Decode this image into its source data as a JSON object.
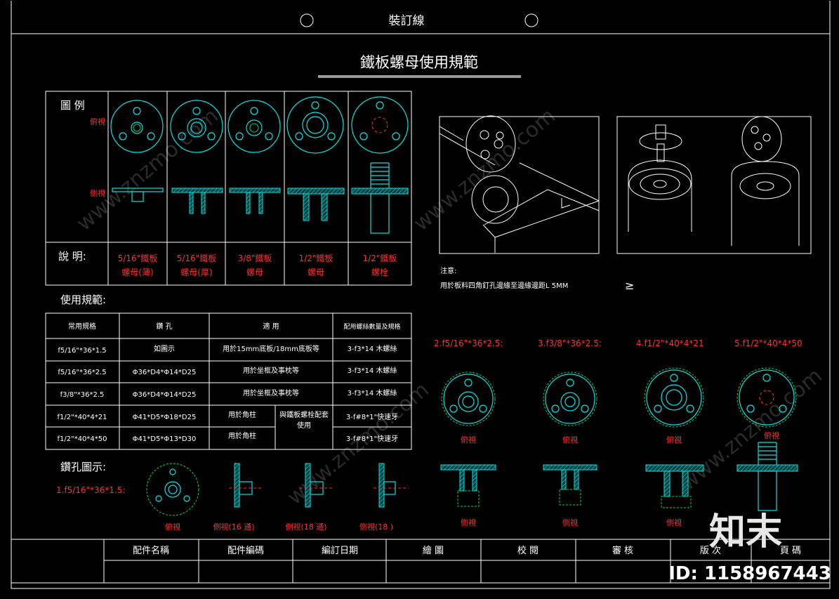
{
  "binding_line": "裝訂線",
  "title": "鐵板螺母使用規範",
  "legend": {
    "label": "圖 例",
    "top_view": "俯視",
    "side_view": "側視",
    "desc_label": "說 明:",
    "items": [
      {
        "line1": "5/16\"鐵板",
        "line2": "螺母(薄)"
      },
      {
        "line1": "5/16\"鐵板",
        "line2": "螺母(厚)"
      },
      {
        "line1": "3/8\"鐵板",
        "line2": "螺母"
      },
      {
        "line1": "1/2\"鐵板",
        "line2": "螺母"
      },
      {
        "line1": "1/2\"鐵板",
        "line2": "螺栓"
      }
    ]
  },
  "usage": {
    "heading": "使用規範:",
    "headers": [
      "常用規格",
      "鑽 孔",
      "適 用",
      "配用螺絲數量及規格"
    ],
    "rows": [
      {
        "spec": "f5/16\"*36*1.5",
        "drill": "如圖示",
        "use": "用於15mm底板/18mm底板等",
        "screw": "3-f3*14 木螺絲"
      },
      {
        "spec": "f5/16\"*36*2.5",
        "drill": "Φ36*D4*Φ14*D25",
        "use": "用於坐框及事枕等",
        "screw": "3-f3*14 木螺絲"
      },
      {
        "spec": "f3/8\"*36*2.5",
        "drill": "Φ36*D4*Φ14*D25",
        "use": "用於坐框及事枕等",
        "screw": "3-f3*14 木螺絲"
      },
      {
        "spec": "f1/2\"*40*4*21",
        "drill": "Φ41*D5*Φ18*D25",
        "use": "用於角柱",
        "screw": "3-f#8*1\"快速牙"
      },
      {
        "spec": "f1/2\"*40*4*50",
        "drill": "Φ41*D5*Φ13*D30",
        "use": "用於角柱",
        "screw": "3-f#8*1\"快速牙"
      }
    ],
    "merged_use": "與鐵板螺栓配套使用"
  },
  "drill_diagram": {
    "heading": "鑽孔圖示:",
    "spec": "1.f5/16\"*36*1.5:",
    "captions": [
      "俯視",
      "側視(16 通)",
      "側視(18 通)",
      "側視(18 )"
    ]
  },
  "note": {
    "label": "注意:",
    "text": "用於板料四角釘孔邊緣至邊緣邊距L 5MM",
    "symbol": "≥"
  },
  "specs_right": {
    "items": [
      {
        "label": "2.f5/16\"*36*2.5:"
      },
      {
        "label": "3.f3/8\"*36*2.5:"
      },
      {
        "label": "4.f1/2\"*40*4*21"
      },
      {
        "label": "5.f1/2\"*40*4*50"
      }
    ],
    "top_caption": "俯視",
    "side_caption": "側視"
  },
  "title_block": {
    "labels": [
      "配件名稱",
      "配件編碼",
      "編訂日期",
      "繪 圖",
      "校 閱",
      "審 核",
      "版 次",
      "頁 碼"
    ]
  },
  "watermark": {
    "brand": "知末",
    "id": "ID: 1158967443",
    "site": "www.znzmo.com"
  },
  "colors": {
    "background": "#000000",
    "line": "#ffffff",
    "cyan": "#00e5e5",
    "red": "#ff3030",
    "green": "#00d060"
  }
}
